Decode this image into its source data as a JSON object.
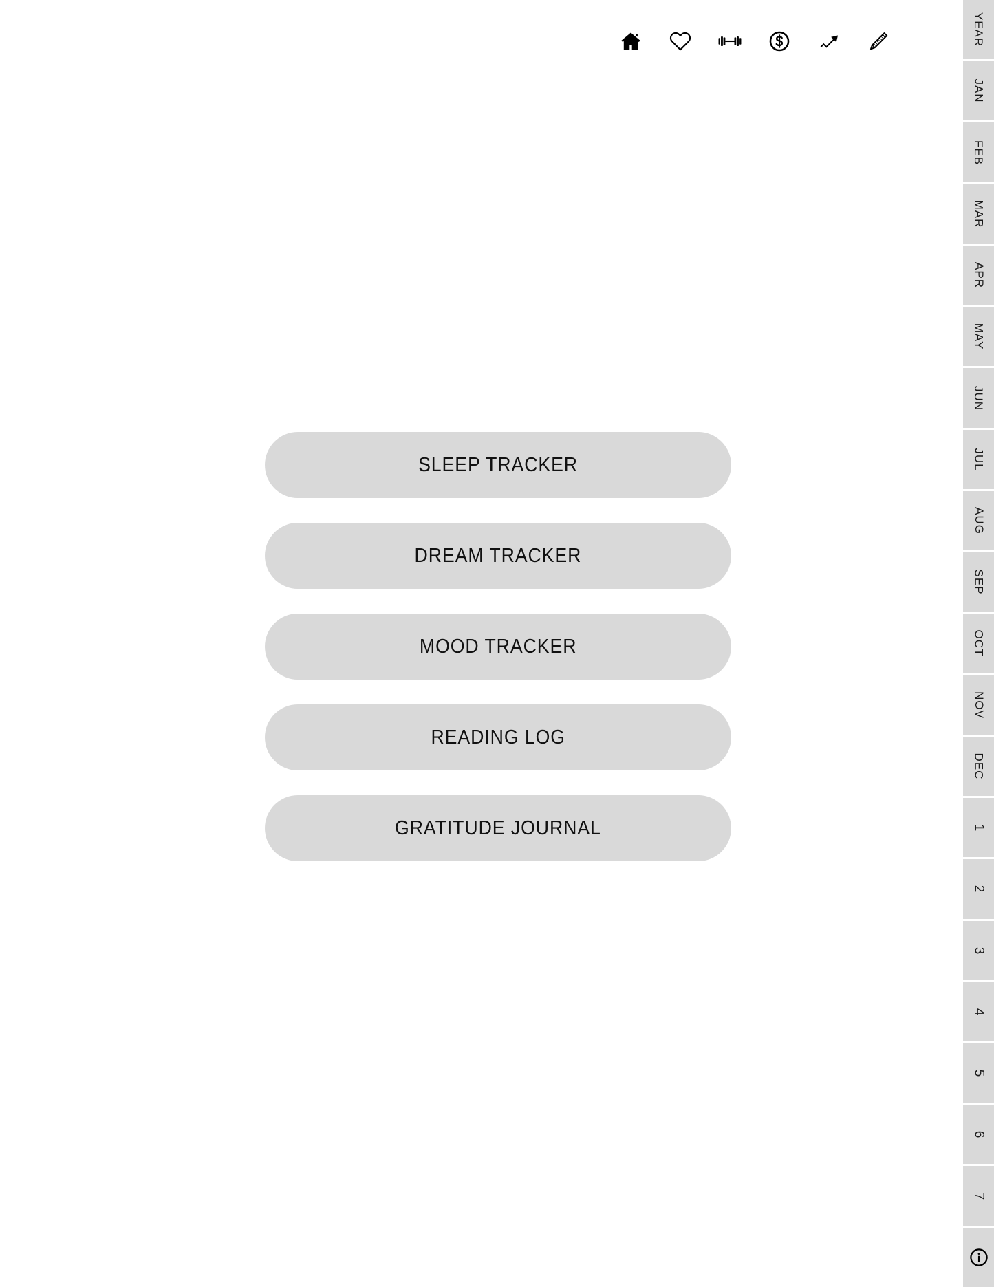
{
  "topbar": {
    "icons": [
      {
        "name": "home-icon",
        "label": "Home"
      },
      {
        "name": "heart-icon",
        "label": "Health"
      },
      {
        "name": "dumbbell-icon",
        "label": "Fitness"
      },
      {
        "name": "dollar-circle-icon",
        "label": "Finance"
      },
      {
        "name": "trending-up-icon",
        "label": "Progress"
      },
      {
        "name": "pencil-icon",
        "label": "Notes"
      }
    ]
  },
  "main": {
    "buttons": [
      {
        "label": "SLEEP TRACKER"
      },
      {
        "label": "DREAM TRACKER"
      },
      {
        "label": "MOOD TRACKER"
      },
      {
        "label": "READING LOG"
      },
      {
        "label": "GRATITUDE JOURNAL"
      }
    ]
  },
  "sidebar": {
    "tabs": [
      {
        "label": "YEAR",
        "kind": "text"
      },
      {
        "label": "JAN",
        "kind": "text"
      },
      {
        "label": "FEB",
        "kind": "text"
      },
      {
        "label": "MAR",
        "kind": "text"
      },
      {
        "label": "APR",
        "kind": "text"
      },
      {
        "label": "MAY",
        "kind": "text"
      },
      {
        "label": "JUN",
        "kind": "text"
      },
      {
        "label": "JUL",
        "kind": "text"
      },
      {
        "label": "AUG",
        "kind": "text"
      },
      {
        "label": "SEP",
        "kind": "text"
      },
      {
        "label": "OCT",
        "kind": "text"
      },
      {
        "label": "NOV",
        "kind": "text"
      },
      {
        "label": "DEC",
        "kind": "text"
      },
      {
        "label": "1",
        "kind": "num"
      },
      {
        "label": "2",
        "kind": "num"
      },
      {
        "label": "3",
        "kind": "num"
      },
      {
        "label": "4",
        "kind": "num"
      },
      {
        "label": "5",
        "kind": "num"
      },
      {
        "label": "6",
        "kind": "num"
      },
      {
        "label": "7",
        "kind": "num"
      },
      {
        "label": "",
        "kind": "icon",
        "icon": "info-circle-icon"
      }
    ]
  },
  "colors": {
    "page_background": "#ffffff",
    "tab_background": "#d9d9d9",
    "button_background": "#d9d9d9",
    "text": "#111111",
    "separator": "#ffffff"
  }
}
